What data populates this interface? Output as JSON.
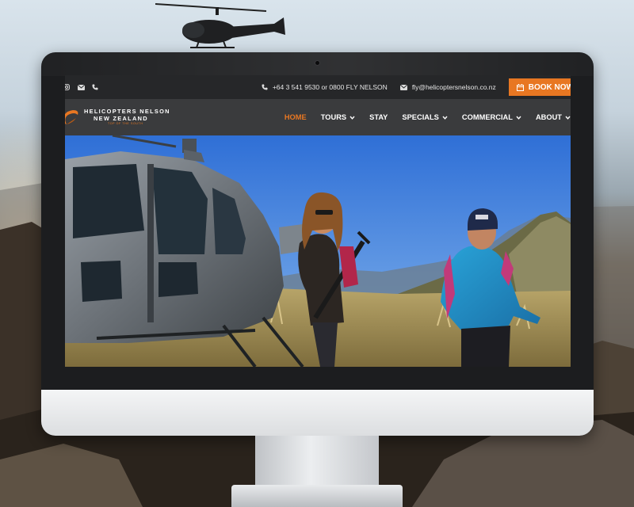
{
  "topbar": {
    "phone": "+64 3 541 9530 or 0800 FLY NELSON",
    "email": "fly@helicoptersnelson.co.nz",
    "book_label": "BOOK NOW",
    "left_icons": [
      "instagram-icon",
      "mail-icon",
      "phone-icon"
    ]
  },
  "logo": {
    "line1": "HELICOPTERS NELSON",
    "line2": "NEW ZEALAND",
    "tagline": "TOP OF THE SOUTH"
  },
  "nav": {
    "items": [
      {
        "label": "HOME",
        "active": true,
        "dropdown": false
      },
      {
        "label": "TOURS",
        "active": false,
        "dropdown": true
      },
      {
        "label": "STAY",
        "active": false,
        "dropdown": false
      },
      {
        "label": "SPECIALS",
        "active": false,
        "dropdown": true
      },
      {
        "label": "COMMERCIAL",
        "active": false,
        "dropdown": true
      },
      {
        "label": "ABOUT",
        "active": false,
        "dropdown": true
      }
    ]
  },
  "colors": {
    "accent": "#e87722",
    "topbar_bg": "#262729",
    "nav_bg": "#3a3b3d"
  }
}
